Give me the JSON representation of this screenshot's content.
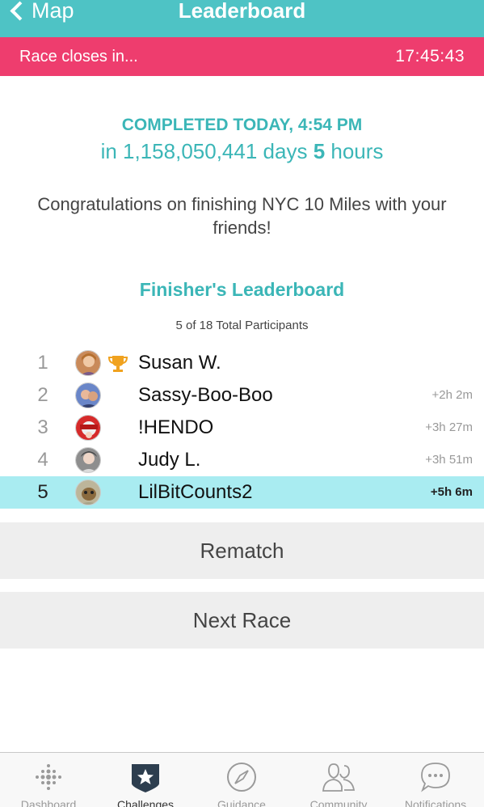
{
  "header": {
    "back_label": "Map",
    "title": "Leaderboard"
  },
  "race_bar": {
    "label": "Race closes in...",
    "countdown": "17:45:43"
  },
  "result": {
    "completed": "COMPLETED TODAY, 4:54 PM",
    "duration_prefix": "in 1,158,050,441 days ",
    "duration_hours": "5",
    "duration_suffix": " hours"
  },
  "congrats": "Congratulations on finishing NYC 10 Miles with your friends!",
  "leaderboard": {
    "title": "Finisher's Leaderboard",
    "participants": "5 of 18 Total Participants",
    "rows": [
      {
        "rank": "1",
        "name": "Susan W.",
        "delta": "",
        "trophy": true
      },
      {
        "rank": "2",
        "name": "Sassy-Boo-Boo",
        "delta": "+2h 2m"
      },
      {
        "rank": "3",
        "name": "!HENDO",
        "delta": "+3h 27m"
      },
      {
        "rank": "4",
        "name": "Judy L.",
        "delta": "+3h 51m"
      },
      {
        "rank": "5",
        "name": "LilBitCounts2",
        "delta": "+5h 6m",
        "highlighted": true
      }
    ]
  },
  "buttons": {
    "rematch": "Rematch",
    "next_race": "Next Race"
  },
  "tabs": [
    {
      "label": "Dashboard",
      "icon": "dots-icon"
    },
    {
      "label": "Challenges",
      "icon": "star-badge-icon",
      "active": true
    },
    {
      "label": "Guidance",
      "icon": "compass-icon"
    },
    {
      "label": "Community",
      "icon": "people-icon"
    },
    {
      "label": "Notifications",
      "icon": "chat-bubble-icon"
    }
  ],
  "colors": {
    "header": "#4ec3c5",
    "race_bar": "#ee3d6e",
    "accent_text": "#3bb6b7",
    "highlight_row": "#a9ecf1",
    "trophy": "#f0a21f"
  }
}
